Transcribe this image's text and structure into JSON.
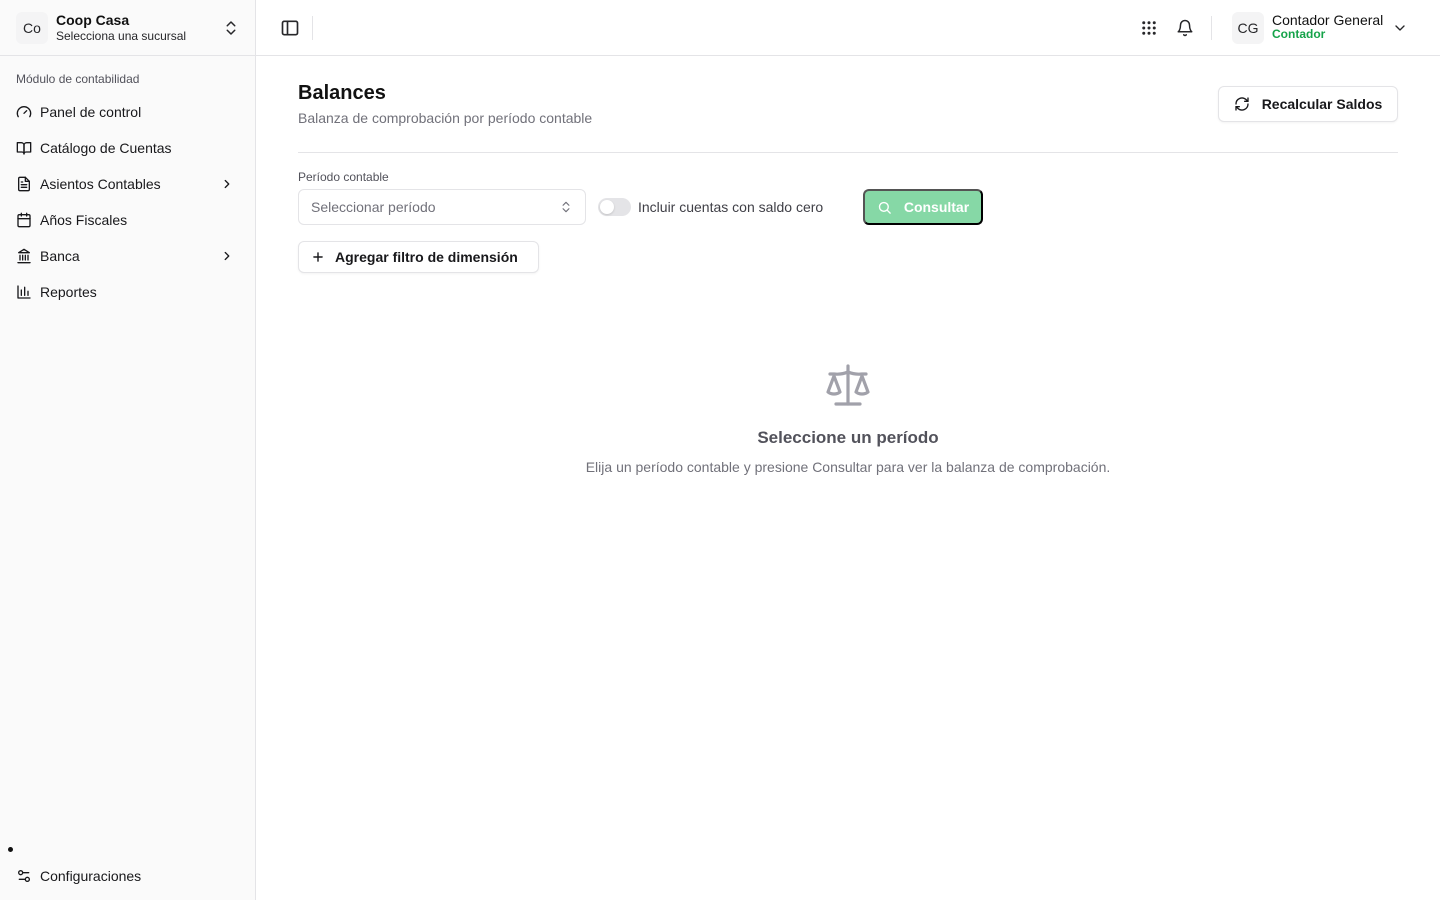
{
  "org": {
    "avatar_text": "Co",
    "name": "Coop Casa",
    "subtitle": "Selecciona una sucursal"
  },
  "sidebar": {
    "section_label": "Módulo de contabilidad",
    "items": [
      {
        "label": "Panel de control",
        "icon": "gauge-icon"
      },
      {
        "label": "Catálogo de Cuentas",
        "icon": "book-open-icon"
      },
      {
        "label": "Asientos Contables",
        "icon": "file-text-icon",
        "expandable": true
      },
      {
        "label": "Años Fiscales",
        "icon": "calendar-icon"
      },
      {
        "label": "Banca",
        "icon": "landmark-icon",
        "expandable": true
      },
      {
        "label": "Reportes",
        "icon": "bar-chart-icon"
      }
    ],
    "footer_item": {
      "label": "Configuraciones",
      "icon": "settings-sliders-icon"
    }
  },
  "topbar": {
    "user": {
      "avatar_text": "CG",
      "name": "Contador General",
      "role": "Contador"
    }
  },
  "page": {
    "title": "Balances",
    "subtitle": "Balanza de comprobación por período contable",
    "recalc_label": "Recalcular Saldos"
  },
  "filters": {
    "period_label": "Período contable",
    "period_placeholder": "Seleccionar período",
    "zero_balance_label": "Incluir cuentas con saldo cero",
    "zero_balance_enabled": false,
    "consult_label": "Consultar",
    "add_dimension_label": "Agregar filtro de dimensión"
  },
  "empty_state": {
    "icon": "scale-icon",
    "title": "Seleccione un período",
    "text": "Elija un período contable y presione Consultar para ver la balanza de comprobación."
  },
  "colors": {
    "accent": "#16a34a",
    "consult_disabled": "#86d8a6",
    "border": "#e4e4e7"
  }
}
